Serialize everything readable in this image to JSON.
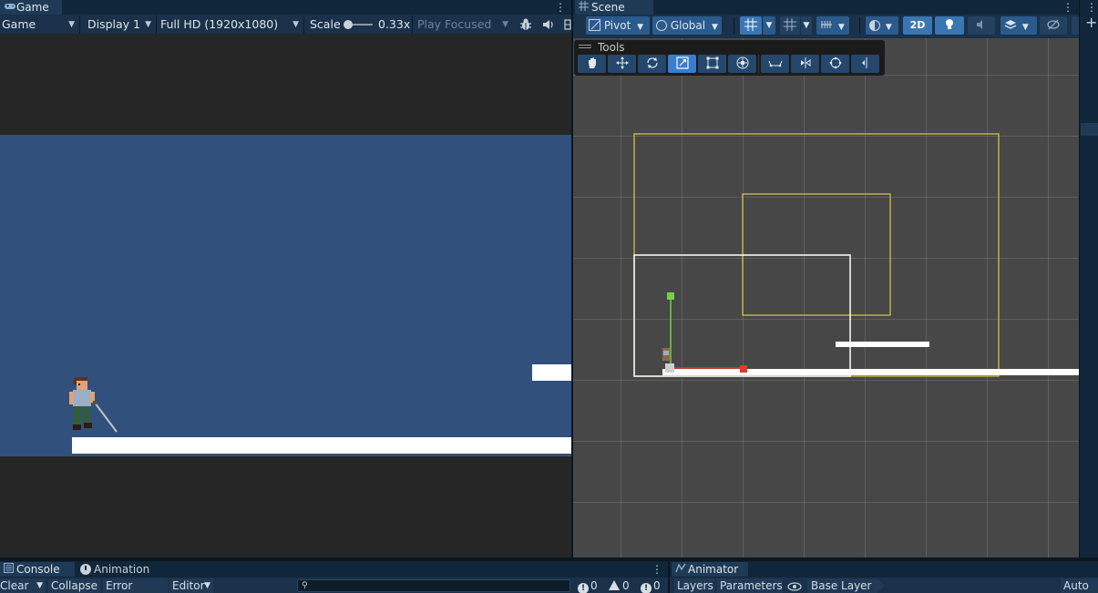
{
  "game": {
    "tab_icon": "gamepad-icon",
    "tab_label": "Game",
    "toolbar": {
      "mode": "Game",
      "display": "Display 1",
      "resolution": "Full HD (1920x1080)",
      "scale_label": "Scale",
      "scale_value": "0.33x",
      "play_mode": "Play Focused"
    }
  },
  "scene": {
    "tab_icon": "grid-icon",
    "tab_label": "Scene",
    "toolbar": {
      "pivot": "Pivot",
      "global": "Global",
      "mode_2d": "2D"
    },
    "tools_overlay": {
      "title": "Tools",
      "tools": [
        "hand-tool-icon",
        "move-tool-icon",
        "rotate-tool-icon",
        "scale-tool-icon",
        "rect-tool-icon",
        "transform-tool-icon",
        "custom-tool-1-icon",
        "custom-tool-2-icon",
        "custom-tool-3-icon",
        "custom-tool-4-icon"
      ],
      "active_tool": "scale-tool-icon"
    }
  },
  "console": {
    "tab_label": "Console",
    "animation_tab_label": "Animation",
    "clear": "Clear",
    "collapse": "Collapse",
    "error_pause": "Error Pause",
    "editor": "Editor",
    "log_count": "0",
    "warning_count": "0",
    "error_count": "0"
  },
  "animator": {
    "tab_label": "Animator",
    "layers": "Layers",
    "parameters": "Parameters",
    "base_layer": "Base Layer",
    "auto_live": "Auto L"
  },
  "colors": {
    "panel_bg": "#1a3149",
    "game_sky": "#31507c",
    "game_letterbox": "#262626",
    "scene_bg": "#474747",
    "camera_yellow": "#d8cc4a",
    "selection_blue": "#3a7ccd"
  }
}
